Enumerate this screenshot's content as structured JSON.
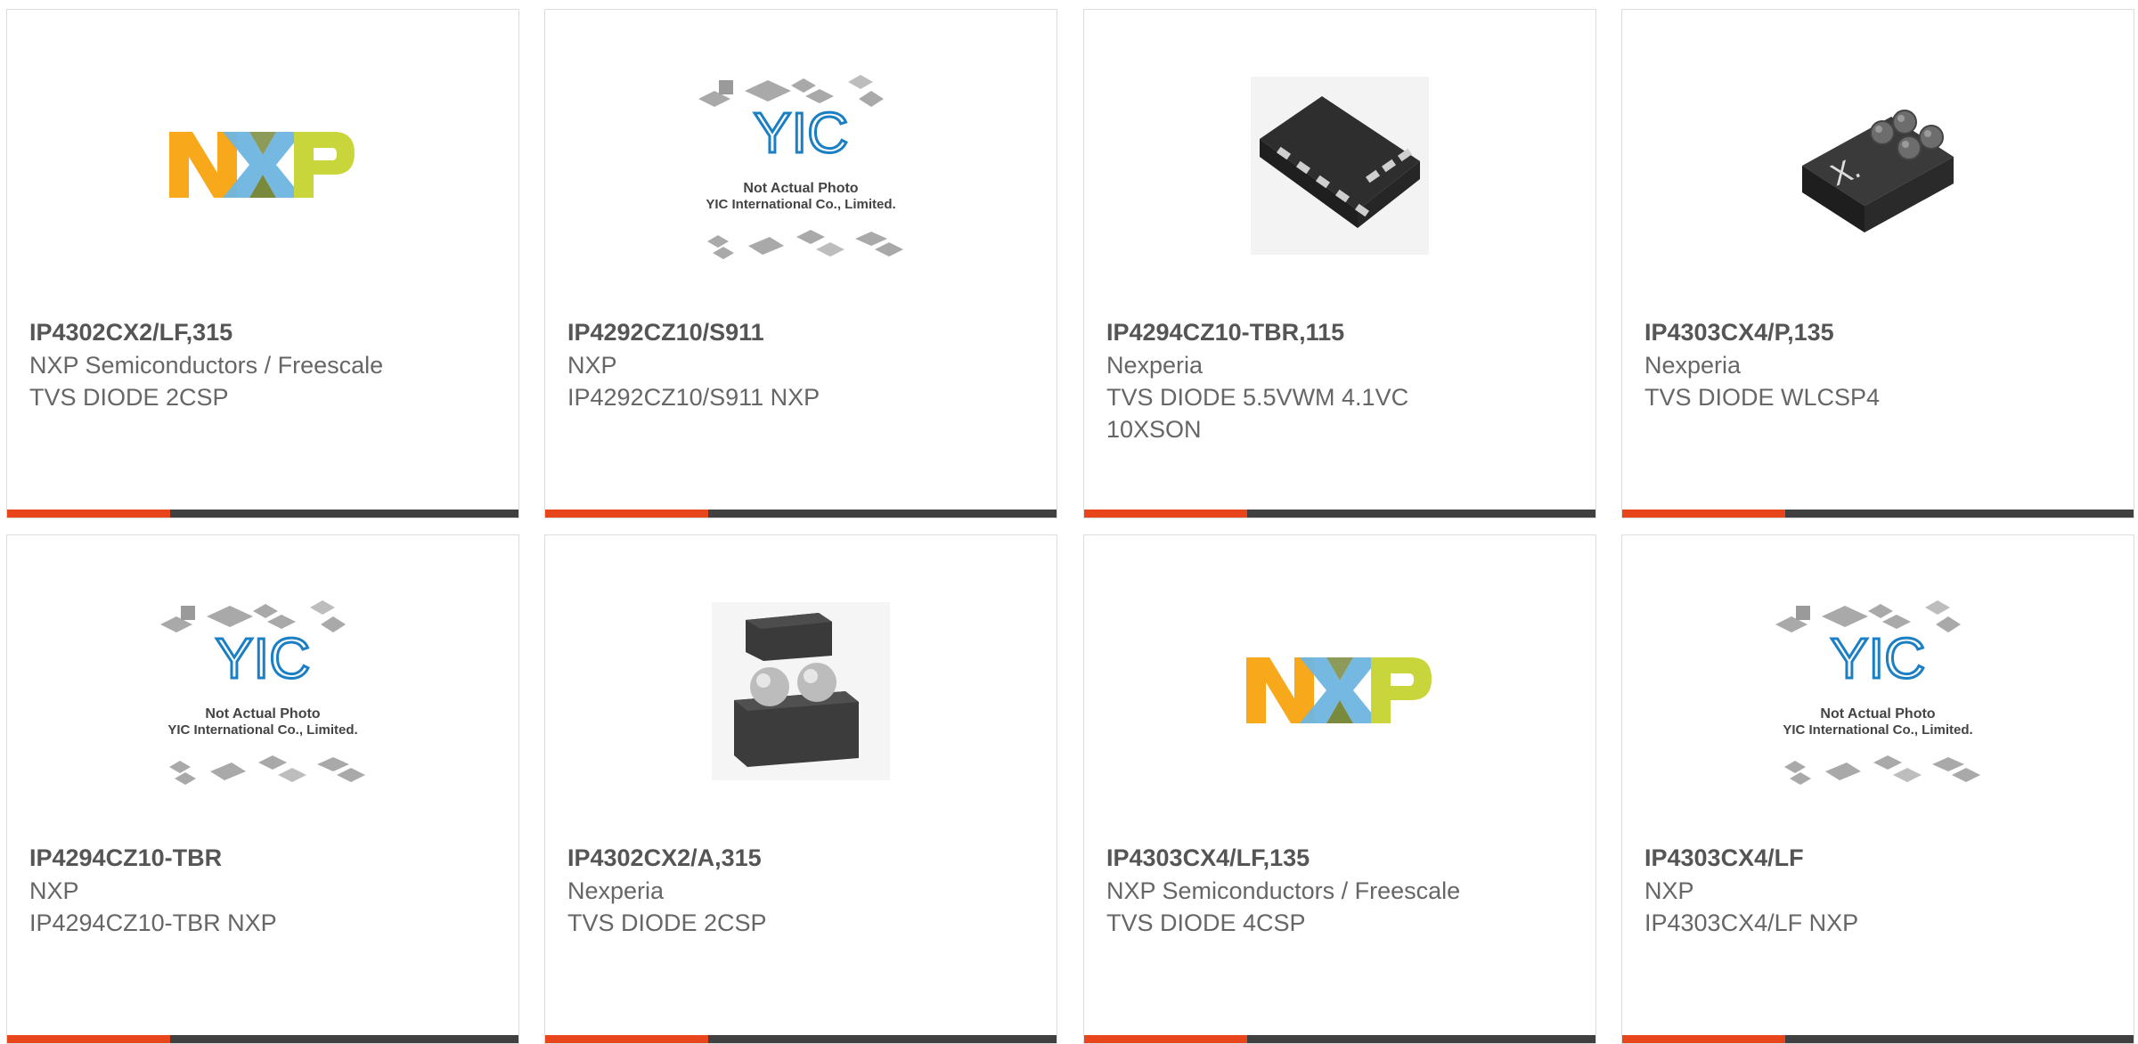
{
  "colors": {
    "accent": "#e8451c",
    "bar": "#404040",
    "border": "#dddddd",
    "title": "#555555",
    "text": "#666666"
  },
  "products": [
    {
      "part": "IP4302CX2/LF,315",
      "manufacturer": "NXP Semiconductors / Freescale",
      "description": "TVS DIODE 2CSP",
      "image": "nxp-logo"
    },
    {
      "part": "IP4292CZ10/S911",
      "manufacturer": "NXP",
      "description": "IP4292CZ10/S911 NXP",
      "image": "yic-placeholder"
    },
    {
      "part": "IP4294CZ10-TBR,115",
      "manufacturer": "Nexperia",
      "description": "TVS DIODE 5.5VWM 4.1VC 10XSON",
      "image": "xson-chip"
    },
    {
      "part": "IP4303CX4/P,135",
      "manufacturer": "Nexperia",
      "description": "TVS DIODE WLCSP4",
      "image": "wlcsp-chip"
    },
    {
      "part": "IP4294CZ10-TBR",
      "manufacturer": "NXP",
      "description": "IP4294CZ10-TBR NXP",
      "image": "yic-placeholder"
    },
    {
      "part": "IP4302CX2/A,315",
      "manufacturer": "Nexperia",
      "description": "TVS DIODE 2CSP",
      "image": "csp-chip"
    },
    {
      "part": "IP4303CX4/LF,135",
      "manufacturer": "NXP Semiconductors / Freescale",
      "description": "TVS DIODE 4CSP",
      "image": "nxp-logo"
    },
    {
      "part": "IP4303CX4/LF",
      "manufacturer": "NXP",
      "description": "IP4303CX4/LF NXP",
      "image": "yic-placeholder"
    }
  ],
  "placeholder": {
    "caption1": "Not Actual Photo",
    "caption2": "YIC International Co., Limited.",
    "brand": "YIC"
  },
  "nxp_logo": {
    "letter1": "N",
    "letter2": "X",
    "letter3": "P"
  }
}
